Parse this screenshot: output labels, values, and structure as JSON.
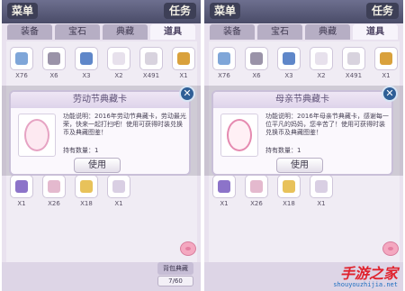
{
  "header": {
    "menu": "菜单",
    "section": "任务"
  },
  "tabs": [
    "装备",
    "宝石",
    "典藏",
    "道具"
  ],
  "grid_counts": {
    "row1": [
      "X76",
      "X6",
      "X3",
      "X2",
      "X491",
      "X1"
    ],
    "row4": [
      "X1",
      "X26",
      "X18",
      "X1"
    ]
  },
  "left_dialog": {
    "title": "劳动节典藏卡",
    "desc": "功能说明：2016年劳动节典藏卡，劳动最光荣，快来一起打扫吧！使用可获得时装兑换币及典藏图鉴！",
    "owned": "持有数量：1",
    "use": "使用"
  },
  "right_dialog": {
    "title": "母亲节典藏卡",
    "desc": "功能说明：2016年母亲节典藏卡，感谢每一位平凡的妈妈，您辛苦了！使用可获得时装兑换币及典藏图鉴！",
    "owned": "持有数量：1",
    "use": "使用"
  },
  "bottom": {
    "bag": "背包典藏",
    "capacity": "7/60"
  },
  "watermark": {
    "brand": "手游之家",
    "url": "shouyouzhijia.net"
  },
  "colors": {
    "accent": "#2f5f96",
    "brand_red": "#e0232e"
  }
}
